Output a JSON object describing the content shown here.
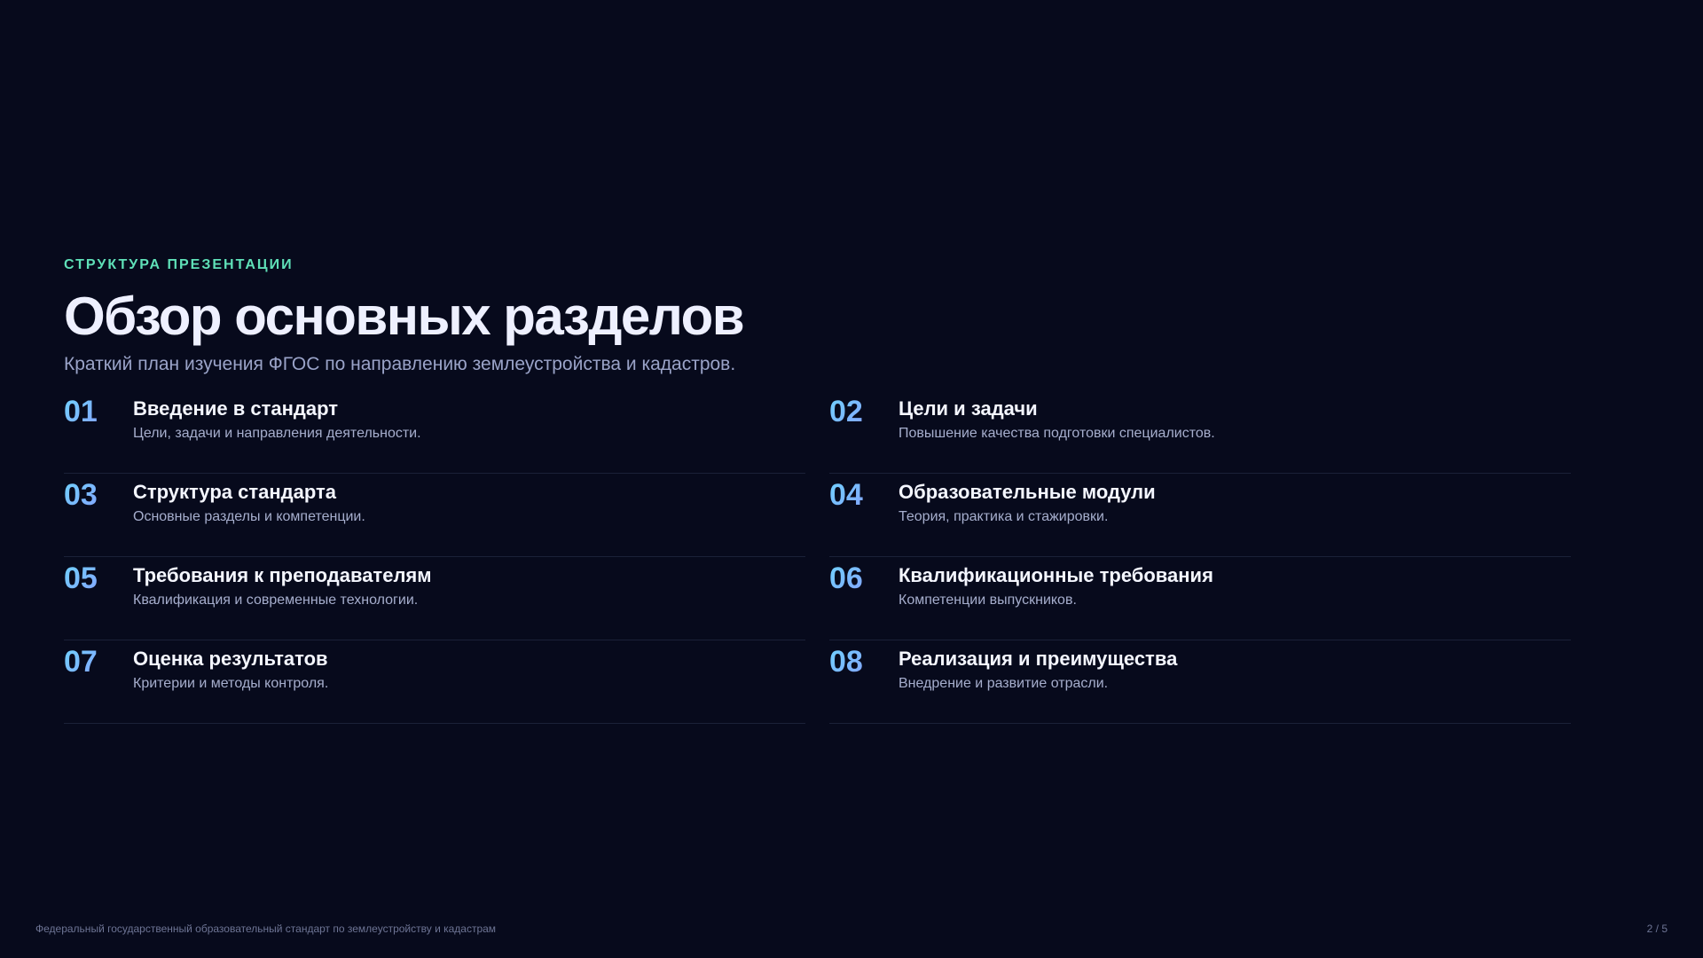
{
  "header": {
    "eyebrow": "СТРУКТУРА ПРЕЗЕНТАЦИИ",
    "title": "Обзор основных разделов",
    "subtitle": "Краткий план изучения ФГОС по направлению землеустройства и кадастров."
  },
  "sections": [
    {
      "num": "01",
      "title": "Введение в стандарт",
      "desc": "Цели, задачи и направления деятельности."
    },
    {
      "num": "02",
      "title": "Цели и задачи",
      "desc": "Повышение качества подготовки специалистов."
    },
    {
      "num": "03",
      "title": "Структура стандарта",
      "desc": "Основные разделы и компетенции."
    },
    {
      "num": "04",
      "title": "Образовательные модули",
      "desc": "Теория, практика и стажировки."
    },
    {
      "num": "05",
      "title": "Требования к преподавателям",
      "desc": "Квалификация и современные технологии."
    },
    {
      "num": "06",
      "title": "Квалификационные требования",
      "desc": "Компетенции выпускников."
    },
    {
      "num": "07",
      "title": "Оценка результатов",
      "desc": "Критерии и методы контроля."
    },
    {
      "num": "08",
      "title": "Реализация и преимущества",
      "desc": "Внедрение и развитие отрасли."
    }
  ],
  "footer": {
    "caption": "Федеральный государственный образовательный стандарт по землеустройству и кадастрам",
    "page": "2 / 5"
  },
  "colors": {
    "background": "#070a1c",
    "accent_eyebrow": "#5fe0b8",
    "number_gradient_start": "#6fd3ff",
    "number_gradient_end": "#8f8cff"
  }
}
